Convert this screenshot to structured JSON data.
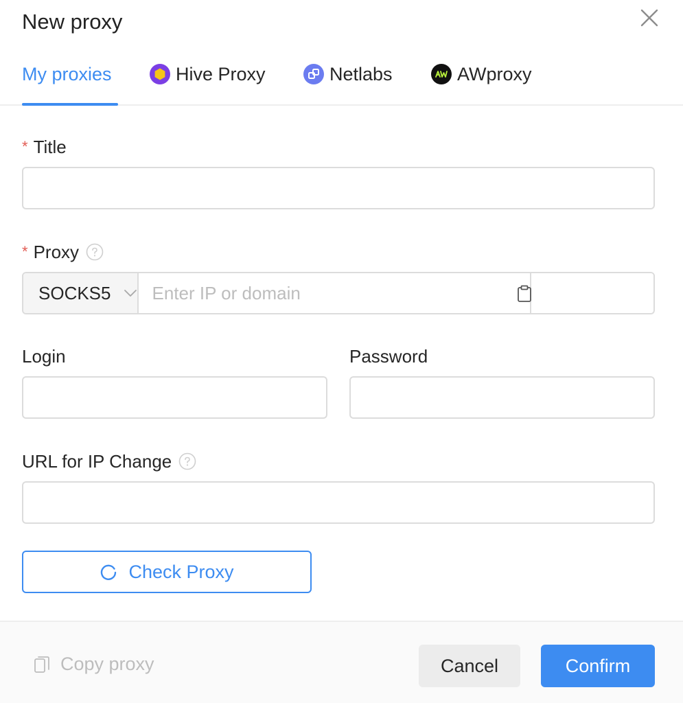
{
  "dialog": {
    "title": "New proxy"
  },
  "tabs": [
    {
      "label": "My proxies",
      "active": true
    },
    {
      "label": "Hive Proxy",
      "icon": "hive-proxy-logo-icon"
    },
    {
      "label": "Netlabs",
      "icon": "netlabs-logo-icon"
    },
    {
      "label": "AWproxy",
      "icon": "awproxy-logo-icon"
    }
  ],
  "form": {
    "title_label": "Title",
    "title_value": "",
    "proxy_label": "Proxy",
    "proxy_type": "SOCKS5",
    "proxy_host_placeholder": "Enter IP or domain",
    "proxy_host_value": "",
    "proxy_port_value": "",
    "login_label": "Login",
    "login_value": "",
    "password_label": "Password",
    "password_value": "",
    "url_label": "URL for IP Change",
    "url_value": "",
    "check_button": "Check Proxy",
    "required_mark": "*"
  },
  "footer": {
    "copy_label": "Copy proxy",
    "cancel_label": "Cancel",
    "confirm_label": "Confirm"
  },
  "colors": {
    "accent": "#3d8cf1",
    "required": "#e25c54",
    "hive": "#7b3fe4",
    "hive_inner": "#f5c518",
    "netlabs": "#6b7cf0",
    "awproxy": "#111111",
    "awproxy_text": "#b8f03c"
  }
}
